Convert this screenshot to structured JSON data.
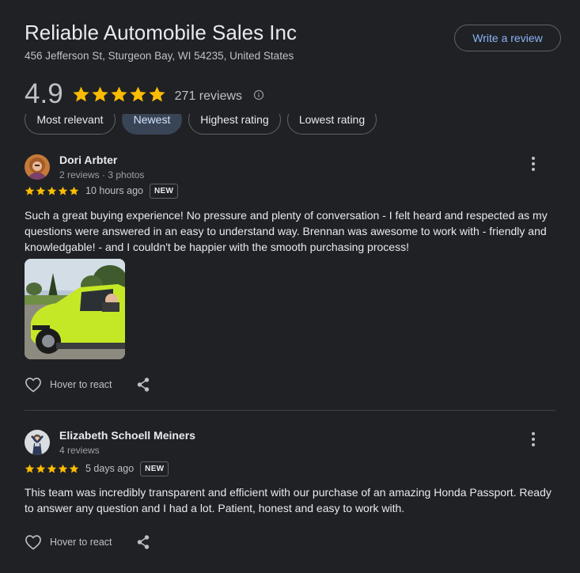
{
  "place": {
    "name": "Reliable Automobile Sales Inc",
    "address": "456 Jefferson St, Sturgeon Bay, WI 54235, United States",
    "write_review_label": "Write a review",
    "rating": "4.9",
    "stars": 5,
    "reviews_count_label": "271 reviews"
  },
  "sort_chips": [
    {
      "label": "Most relevant",
      "active": false
    },
    {
      "label": "Newest",
      "active": true
    },
    {
      "label": "Highest rating",
      "active": false
    },
    {
      "label": "Lowest rating",
      "active": false
    }
  ],
  "reviews": [
    {
      "author": "Dori Arbter",
      "meta": "2 reviews · 3 photos",
      "stars": 5,
      "when": "10 hours ago",
      "badge": "NEW",
      "text": "Such a great buying experience! No pressure and plenty of conversation - I felt heard and respected as my questions were answered in an easy to understand way. Brennan was awesome to work with - friendly and knowledgable! - and I couldn't be happier with the smooth purchasing process!",
      "react_label": "Hover to react"
    },
    {
      "author": "Elizabeth Schoell Meiners",
      "meta": "4 reviews",
      "stars": 5,
      "when": "5 days ago",
      "badge": "NEW",
      "text": "This team was incredibly transparent and efficient with our purchase of an amazing Honda Passport. Ready to answer any question and I had a lot. Patient, honest and easy to work with.",
      "react_label": "Hover to react"
    }
  ],
  "colors": {
    "background": "#202124",
    "star": "#fbbc04",
    "link": "#8ab4f8",
    "active_chip": "#394457"
  }
}
